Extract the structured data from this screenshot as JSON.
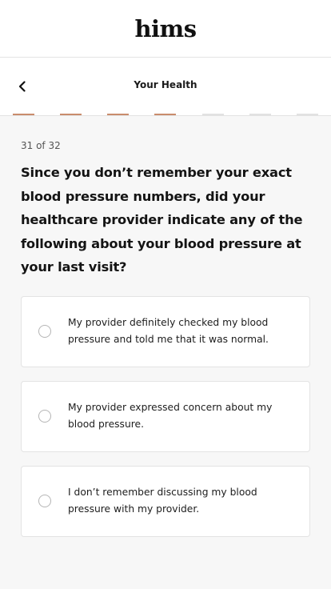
{
  "header": {
    "logo": "hims"
  },
  "subheader": {
    "title": "Your Health",
    "back_icon": "chevron-left-icon"
  },
  "progress": {
    "total_segments": 7,
    "completed_segments": 4,
    "accent": "#c98c6c"
  },
  "step": "31 of 32",
  "question": "Since you don’t remember your exact blood pressure numbers, did your healthcare provider indicate any of the following about your blood pressure at your last visit?",
  "options": [
    {
      "label": "My provider definitely checked my blood pressure and told me that it was normal."
    },
    {
      "label": "My provider expressed concern about my blood pressure."
    },
    {
      "label": "I don’t remember discussing my blood pressure with my provider."
    }
  ]
}
